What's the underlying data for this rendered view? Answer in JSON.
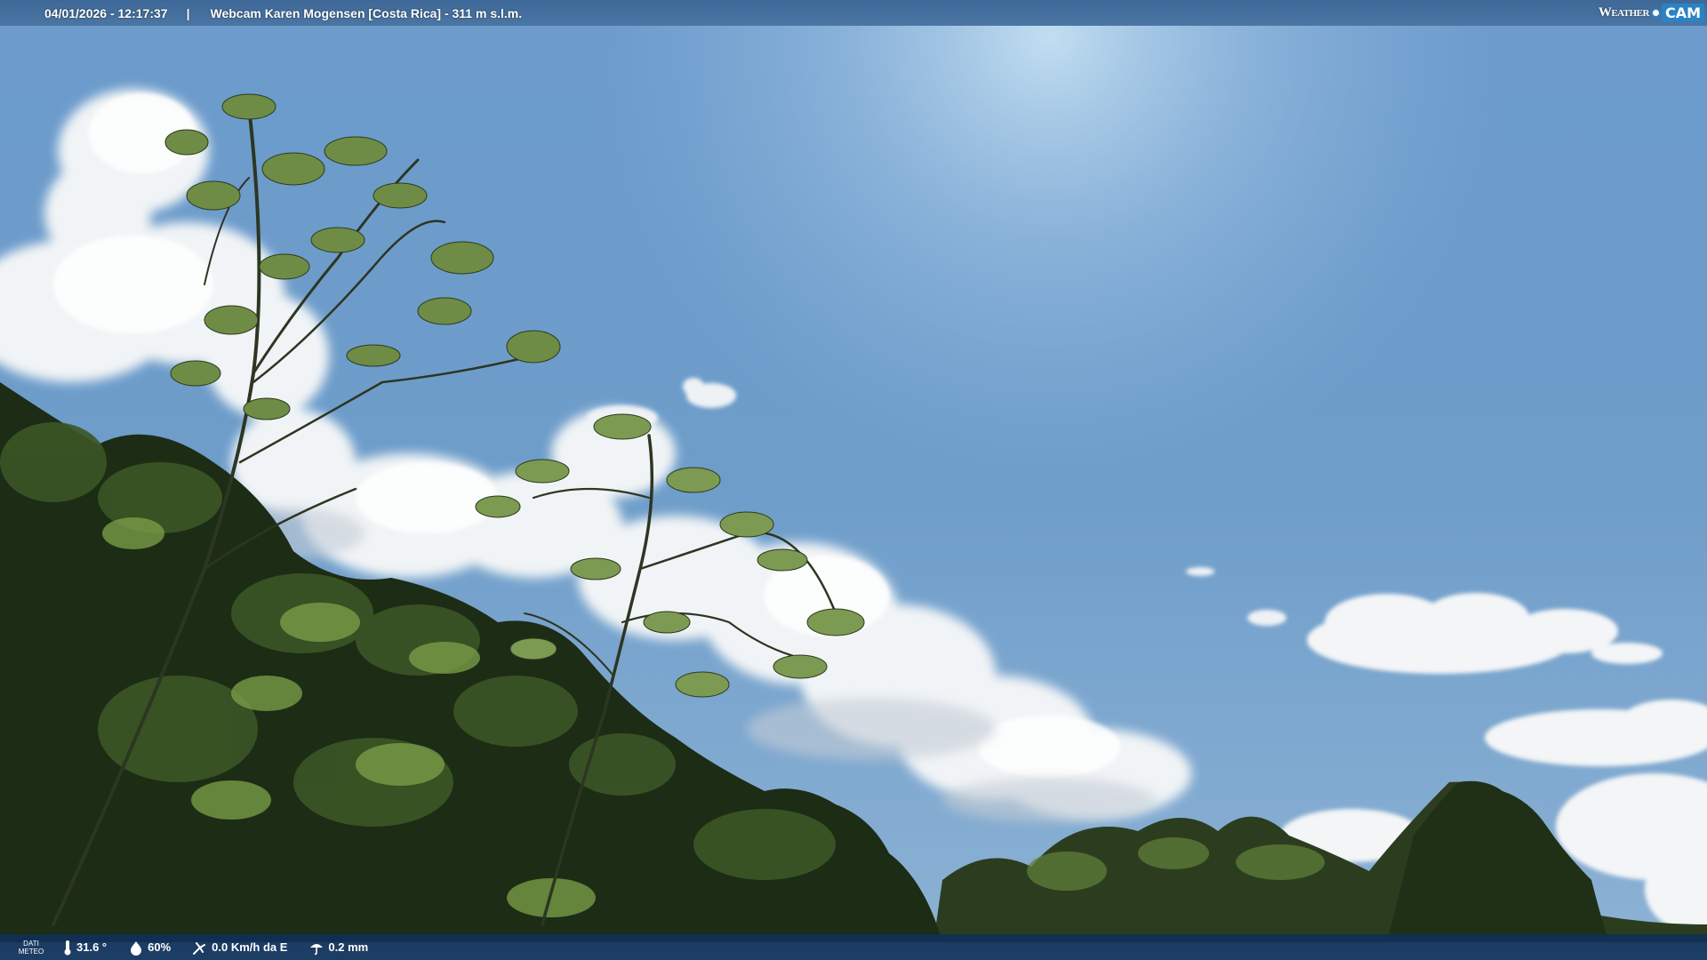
{
  "header": {
    "datetime": "04/01/2026 - 12:17:37",
    "separator": "|",
    "title": "Webcam Karen Mogensen [Costa Rica] - 311 m s.l.m."
  },
  "logo": {
    "weather_text": "Weather",
    "cam_text": "CAM"
  },
  "weather_bar": {
    "label_line1": "DATI",
    "label_line2": "METEO",
    "temperature": "31.6 °",
    "humidity": "60%",
    "wind": "0.0 Km/h da E",
    "rain": "0.2 mm"
  },
  "icons": [
    "thermometer-icon",
    "humidity-drop-icon",
    "wind-icon",
    "rain-icon"
  ],
  "colors": {
    "sky_top": "#6f9bcb",
    "sky_glow": "#bcd9ee",
    "foliage_dark": "#1d2e15",
    "foliage_light": "#7ca04b",
    "bar": "#0f3058",
    "logo_accent": "#2b83c4"
  }
}
